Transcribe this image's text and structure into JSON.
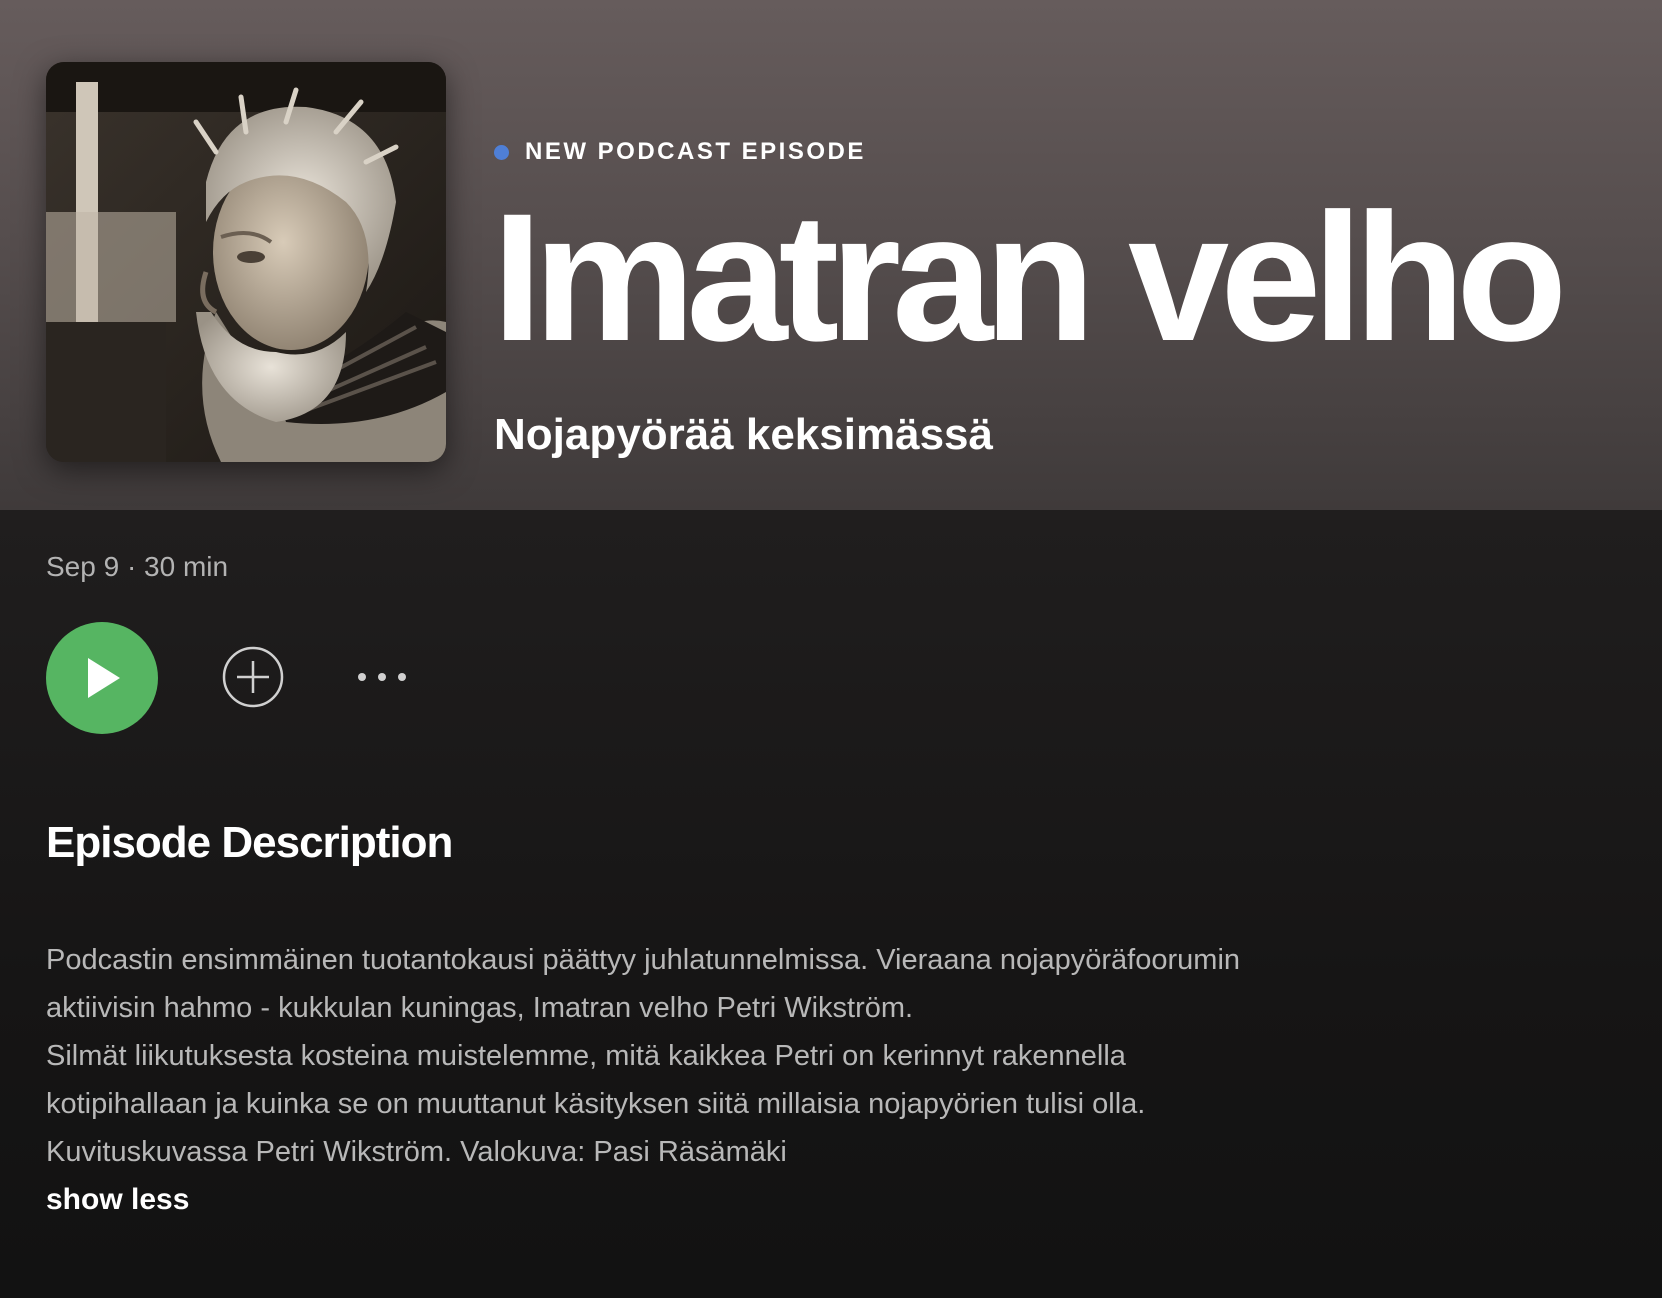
{
  "episode": {
    "badge": "NEW PODCAST EPISODE",
    "title": "Imatran velho",
    "show_name": "Nojapyörää keksimässä",
    "meta": "Sep 9 · 30 min"
  },
  "controls": {
    "play_icon": "play-icon",
    "add_icon": "plus-circle-icon",
    "more_icon": "ellipsis-icon"
  },
  "description": {
    "heading": "Episode Description",
    "lines": [
      "Podcastin ensimmäinen tuotantokausi päättyy juhlatunnelmissa. Vieraana nojapyöräfoorumin",
      "aktiivisin hahmo - kukkulan kuningas, Imatran velho Petri Wikström.",
      "Silmät liikutuksesta kosteina muistelemme, mitä kaikkea Petri on kerinnyt rakennella",
      "kotipihallaan ja kuinka se on muuttanut käsityksen siitä millaisia nojapyörien tulisi olla.",
      "Kuvituskuvassa Petri Wikström. Valokuva: Pasi Räsämäki"
    ],
    "toggle_label": "show less"
  },
  "colors": {
    "accent_green": "#56b562",
    "badge_blue": "#4f7fd6",
    "header_bg": "#5e5656",
    "body_bg": "#121212"
  }
}
